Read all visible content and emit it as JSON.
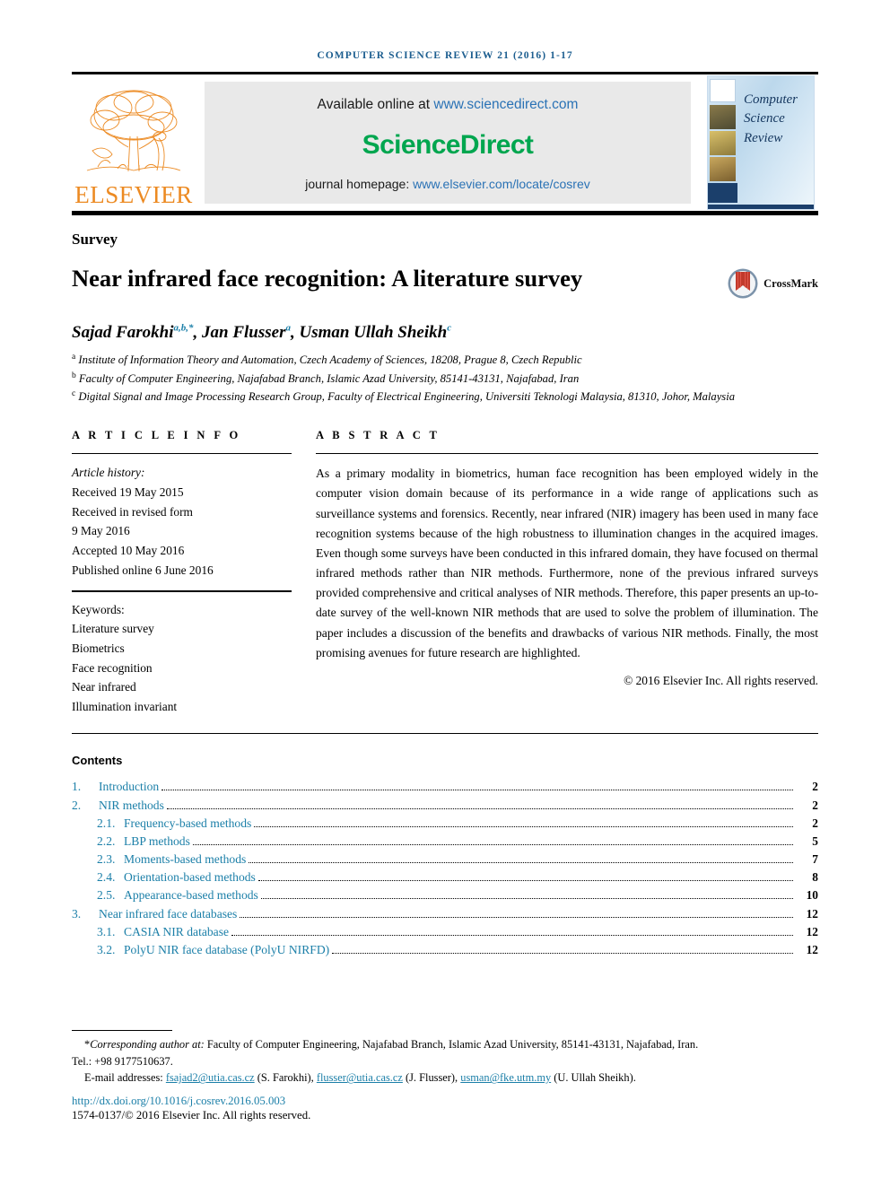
{
  "running_head": "COMPUTER SCIENCE REVIEW 21 (2016) 1-17",
  "masthead": {
    "publisher_name": "ELSEVIER",
    "available_online_prefix": "Available online at ",
    "available_online_link": "www.sciencedirect.com",
    "sciencedirect_part1": "Science",
    "sciencedirect_part2": "Direct",
    "homepage_prefix": "journal homepage: ",
    "homepage_link": "www.elsevier.com/locate/cosrev",
    "cover_title_line1": "Computer",
    "cover_title_line2": "Science",
    "cover_title_line3": "Review"
  },
  "article": {
    "type_label": "Survey",
    "title": "Near infrared face recognition: A literature survey",
    "crossmark_label": "CrossMark",
    "authors": [
      {
        "name": "Sajad Farokhi",
        "marks": "a,b,*"
      },
      {
        "name": "Jan Flusser",
        "marks": "a"
      },
      {
        "name": "Usman Ullah Sheikh",
        "marks": "c"
      }
    ],
    "affiliations": [
      {
        "mark": "a",
        "text": "Institute of Information Theory and Automation, Czech Academy of Sciences, 18208, Prague 8, Czech Republic"
      },
      {
        "mark": "b",
        "text": "Faculty of Computer Engineering, Najafabad Branch, Islamic Azad University, 85141-43131, Najafabad, Iran"
      },
      {
        "mark": "c",
        "text": "Digital Signal and Image Processing Research Group, Faculty of Electrical Engineering, Universiti Teknologi Malaysia, 81310, Johor, Malaysia"
      }
    ]
  },
  "article_info": {
    "heading": "A R T I C L E   I N F O",
    "history_label": "Article history:",
    "history": [
      "Received 19 May 2015",
      "Received in revised form",
      "9 May 2016",
      "Accepted 10 May 2016",
      "Published online 6 June 2016"
    ],
    "keywords_label": "Keywords:",
    "keywords": [
      "Literature survey",
      "Biometrics",
      "Face recognition",
      "Near infrared",
      "Illumination invariant"
    ]
  },
  "abstract": {
    "heading": "A B S T R A C T",
    "text": "As a primary modality in biometrics, human face recognition has been employed widely in the computer vision domain because of its performance in a wide range of applications such as surveillance systems and forensics. Recently, near infrared (NIR) imagery has been used in many face recognition systems because of the high robustness to illumination changes in the acquired images. Even though some surveys have been conducted in this infrared domain, they have focused on thermal infrared methods rather than NIR methods. Furthermore, none of the previous infrared surveys provided comprehensive and critical analyses of NIR methods. Therefore, this paper presents an up-to-date survey of the well-known NIR methods that are used to solve the problem of illumination. The paper includes a discussion of the benefits and drawbacks of various NIR methods. Finally, the most promising avenues for future research are highlighted.",
    "copyright": "© 2016 Elsevier Inc. All rights reserved."
  },
  "contents": {
    "heading": "Contents",
    "items": [
      {
        "number": "1.",
        "level": 1,
        "label": "Introduction",
        "page": "2"
      },
      {
        "number": "2.",
        "level": 1,
        "label": "NIR methods",
        "page": "2"
      },
      {
        "number": "2.1.",
        "level": 2,
        "label": "Frequency-based methods",
        "page": "2"
      },
      {
        "number": "2.2.",
        "level": 2,
        "label": "LBP methods",
        "page": "5"
      },
      {
        "number": "2.3.",
        "level": 2,
        "label": "Moments-based methods",
        "page": "7"
      },
      {
        "number": "2.4.",
        "level": 2,
        "label": "Orientation-based methods",
        "page": "8"
      },
      {
        "number": "2.5.",
        "level": 2,
        "label": "Appearance-based methods",
        "page": "10"
      },
      {
        "number": "3.",
        "level": 1,
        "label": "Near infrared face databases",
        "page": "12"
      },
      {
        "number": "3.1.",
        "level": 2,
        "label": "CASIA NIR database",
        "page": "12"
      },
      {
        "number": "3.2.",
        "level": 2,
        "label": "PolyU NIR face database (PolyU NIRFD)",
        "page": "12"
      }
    ]
  },
  "footnotes": {
    "corresponding_marker": "*",
    "corresponding_italic": "Corresponding author at:",
    "corresponding_text": " Faculty of Computer Engineering, Najafabad Branch, Islamic Azad University, 85141-43131, Najafabad, Iran.",
    "tel_line": "Tel.: +98 9177510637.",
    "email_label": "E-mail addresses:",
    "emails": [
      {
        "address": "fsajad2@utia.cas.cz",
        "owner": " (S. Farokhi), "
      },
      {
        "address": "flusser@utia.cas.cz",
        "owner": " (J. Flusser), "
      },
      {
        "address": "usman@fke.utm.my",
        "owner": " (U. Ullah Sheikh)."
      }
    ],
    "doi": "http://dx.doi.org/10.1016/j.cosrev.2016.05.003",
    "issn_line": "1574-0137/© 2016 Elsevier Inc. All rights reserved."
  },
  "colors": {
    "link_blue": "#1b7fa8",
    "runhead_blue": "#1b5d8f",
    "elsevier_orange": "#ec8a22",
    "sciencedirect_green": "#00a64f",
    "sd_link": "#2a72b5",
    "cover_navy": "#1b3f6b"
  }
}
